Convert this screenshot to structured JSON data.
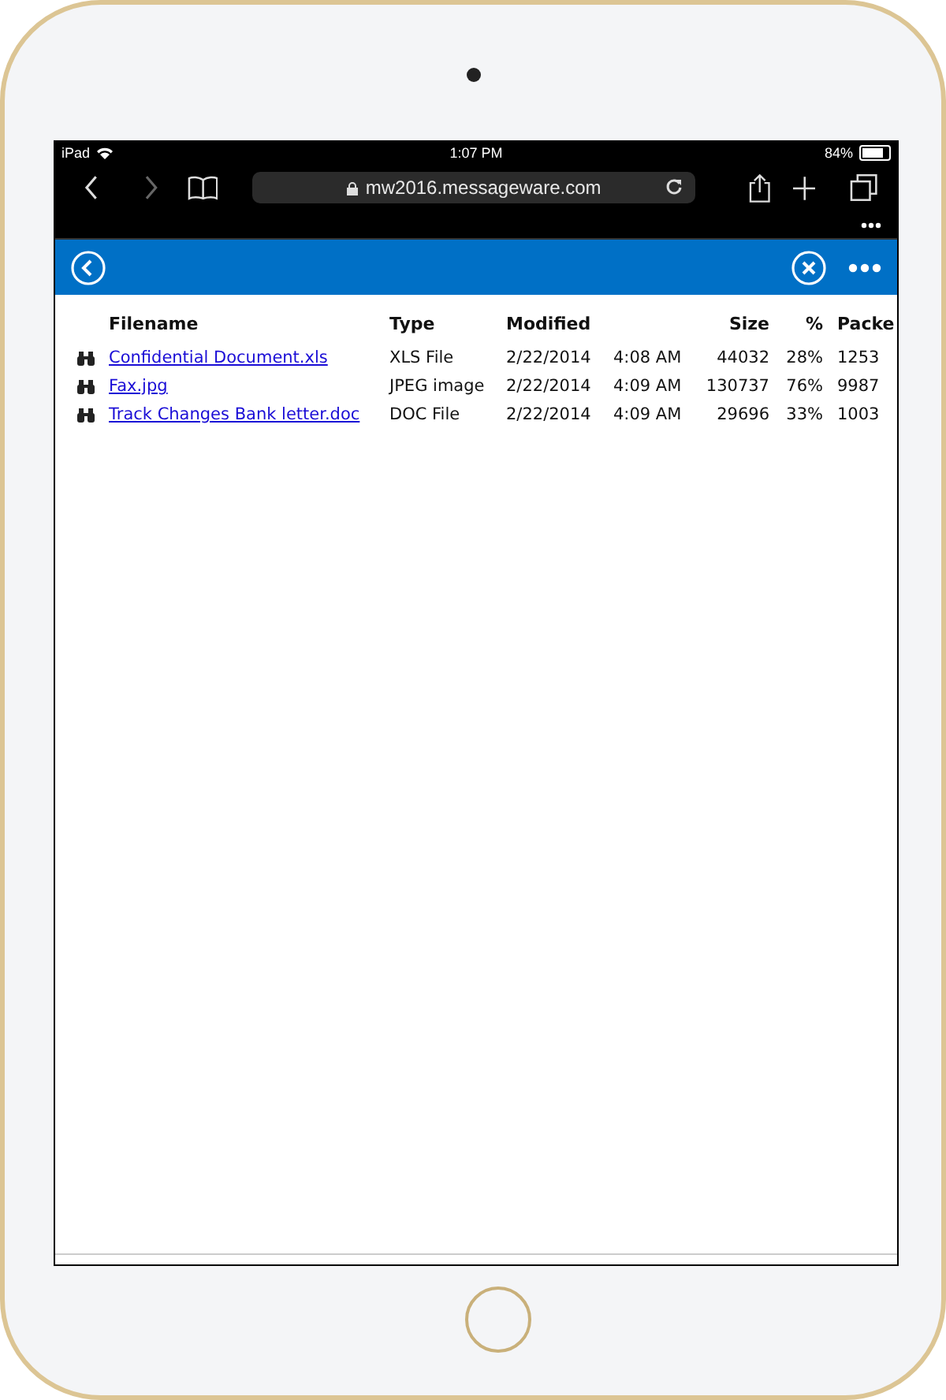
{
  "status_bar": {
    "device": "iPad",
    "time": "1:07 PM",
    "battery": "84%"
  },
  "browser": {
    "url": "mw2016.messageware.com",
    "back_disabled": false,
    "forward_disabled": true
  },
  "table": {
    "columns": [
      {
        "label": "Filename",
        "kind": "text"
      },
      {
        "label": "Type",
        "kind": "text"
      },
      {
        "label": "Modified",
        "kind": "datetime"
      },
      {
        "label": "Size",
        "kind": "number"
      },
      {
        "label": "%",
        "kind": "number"
      },
      {
        "label": "Packe",
        "kind": "text"
      }
    ],
    "rows": [
      {
        "filename": "Confidential Document.xls",
        "type": "XLS File",
        "date": "2/22/2014",
        "time": "4:08 AM",
        "bytes": "44032",
        "percent": "28%",
        "packed": "1253"
      },
      {
        "filename": "Fax.jpg",
        "type": "JPEG image",
        "date": "2/22/2014",
        "time": "4:09 AM",
        "bytes": "130737",
        "percent": "76%",
        "packed": "9987"
      },
      {
        "filename": "Track Changes Bank letter.doc",
        "type": "DOC File",
        "date": "2/22/2014",
        "time": "4:09 AM",
        "bytes": "29696",
        "percent": "33%",
        "packed": "1003"
      }
    ]
  }
}
